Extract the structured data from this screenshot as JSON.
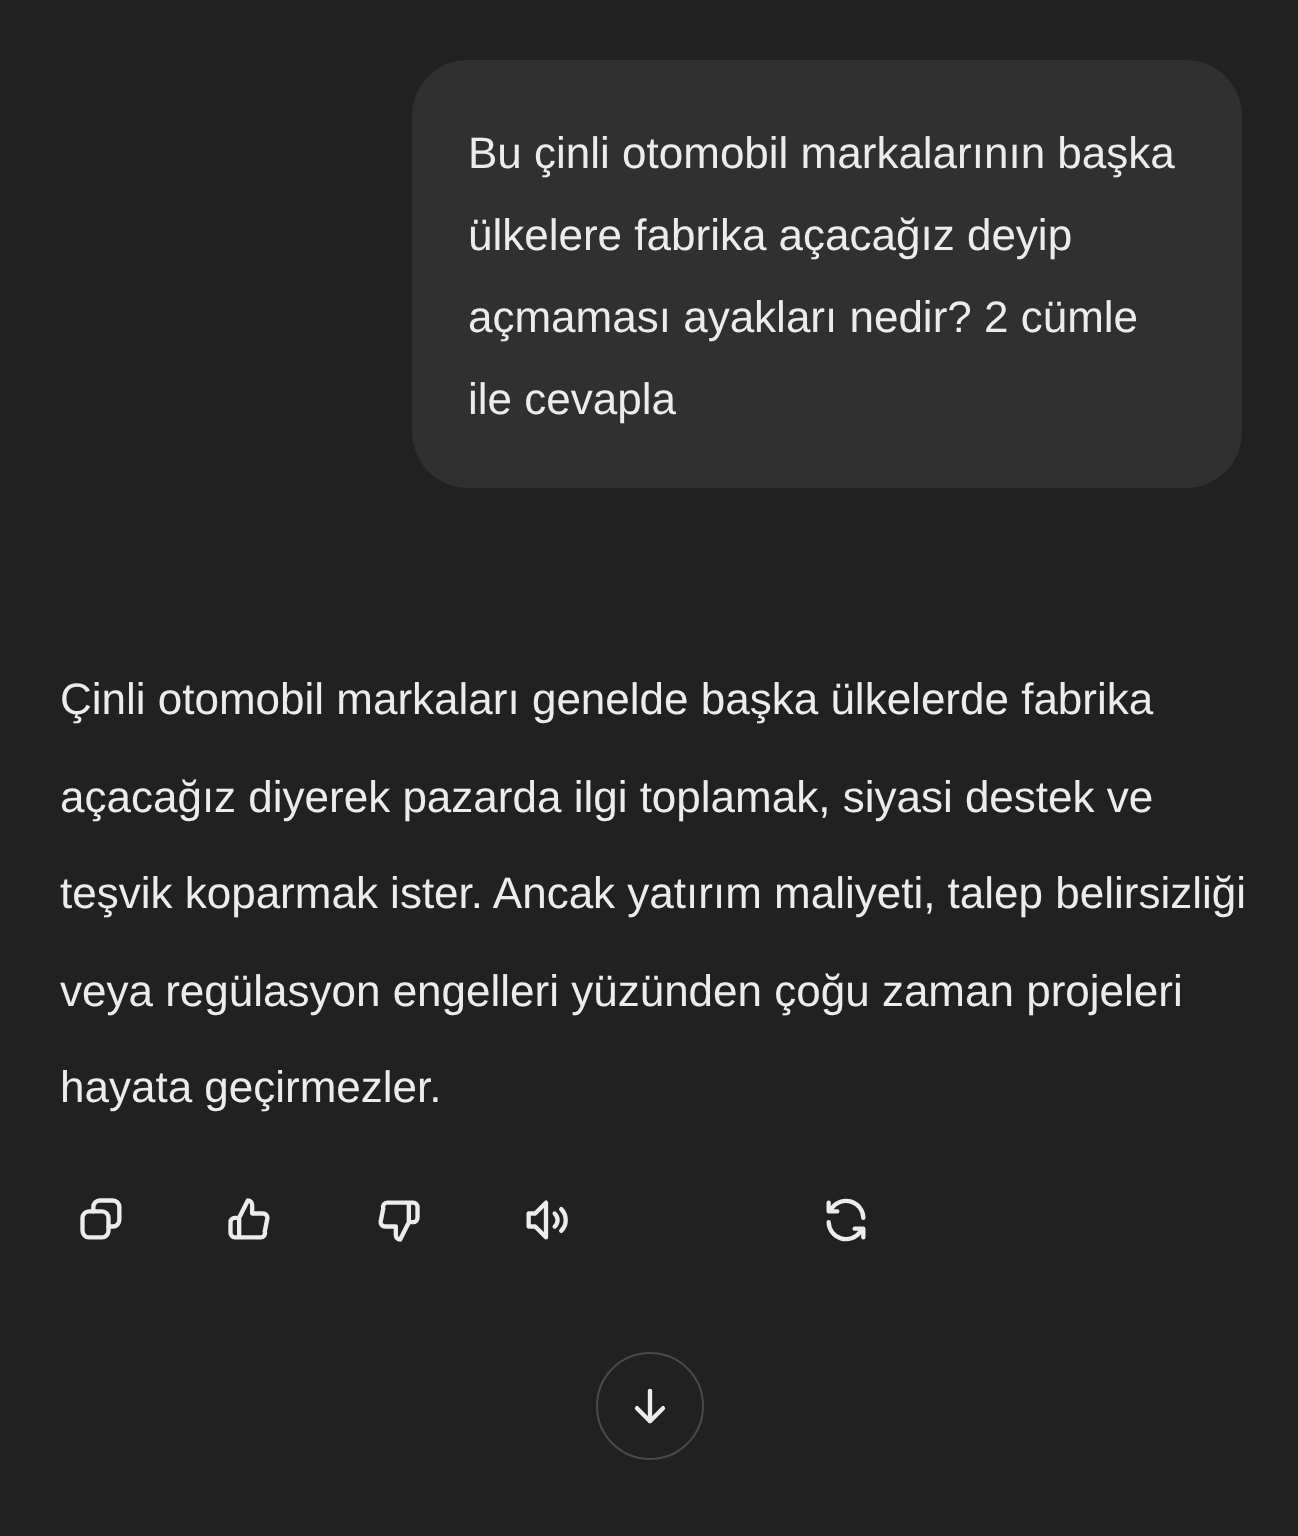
{
  "user_message": {
    "text": "Bu çinli otomobil markalarının başka ülkelere fabrika açacağız deyip açmaması ayakları nedir? 2 cümle ile cevapla"
  },
  "assistant_message": {
    "text": "Çinli otomobil markaları genelde başka ülkelerde fabrika açacağız diyerek pazarda ilgi toplamak, siyasi destek ve teşvik koparmak ister. Ancak yatırım maliyeti, talep belirsizliği veya regülasyon engelleri yüzünden çoğu zaman projeleri hayata geçirmezler."
  },
  "actions": [
    {
      "kind": "copy"
    },
    {
      "kind": "like"
    },
    {
      "kind": "dislike"
    },
    {
      "kind": "speak"
    },
    {
      "kind": "regenerate"
    }
  ],
  "scroll_down_button": {
    "kind": "arrow-down"
  }
}
